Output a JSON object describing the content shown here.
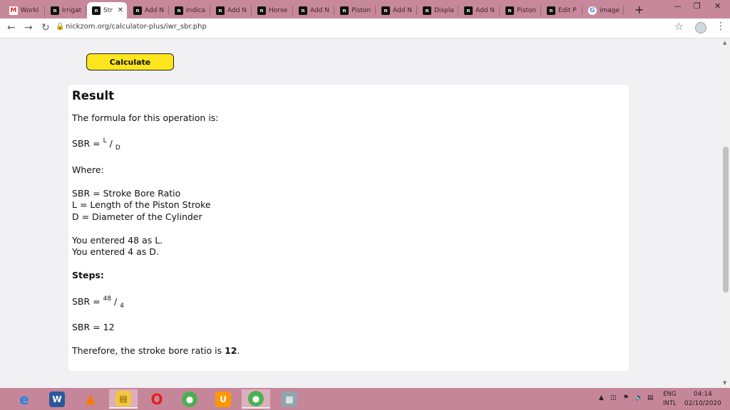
{
  "browser": {
    "tabs": [
      {
        "label": "Workl",
        "icon": "gmail-icon"
      },
      {
        "label": "Irrigat",
        "icon": "nickzom-icon"
      },
      {
        "label": "Str",
        "icon": "nickzom-icon",
        "active": true
      },
      {
        "label": "Add N",
        "icon": "nickzom-icon"
      },
      {
        "label": "Indica",
        "icon": "nickzom-icon"
      },
      {
        "label": "Add N",
        "icon": "nickzom-icon"
      },
      {
        "label": "Horse",
        "icon": "nickzom-icon"
      },
      {
        "label": "Add N",
        "icon": "nickzom-icon"
      },
      {
        "label": "Piston",
        "icon": "nickzom-icon"
      },
      {
        "label": "Add N",
        "icon": "nickzom-icon"
      },
      {
        "label": "Displa",
        "icon": "nickzom-icon"
      },
      {
        "label": "Add N",
        "icon": "nickzom-icon"
      },
      {
        "label": "Piston",
        "icon": "nickzom-icon"
      },
      {
        "label": "Edit P",
        "icon": "nickzom-icon"
      },
      {
        "label": "image",
        "icon": "google-icon"
      }
    ],
    "url": "nickzom.org/calculator-plus/iwr_sbr.php"
  },
  "page": {
    "calculate_label": "Calculate",
    "result_title": "Result",
    "formula_intro": "The formula for this operation is:",
    "formula_lhs": "SBR = ",
    "formula_num": "L",
    "formula_slash": " / ",
    "formula_den": "D",
    "where_label": "Where:",
    "def_sbr": "SBR = Stroke Bore Ratio",
    "def_l": "L = Length of the Piston Stroke",
    "def_d": "D = Diameter of the Cylinder",
    "entered_l": "You entered 48 as L.",
    "entered_d": "You entered 4 as D.",
    "steps_label": "Steps:",
    "step_lhs": "SBR = ",
    "step_num": "48",
    "step_slash": " / ",
    "step_den": "4",
    "step_result": "SBR = 12",
    "conclusion_prefix": "Therefore, the stroke bore ratio is ",
    "conclusion_value": "12",
    "conclusion_suffix": "."
  },
  "taskbar": {
    "language_top": "ENG",
    "language_bottom": "INTL",
    "time": "04:14",
    "date": "02/10/2020"
  }
}
